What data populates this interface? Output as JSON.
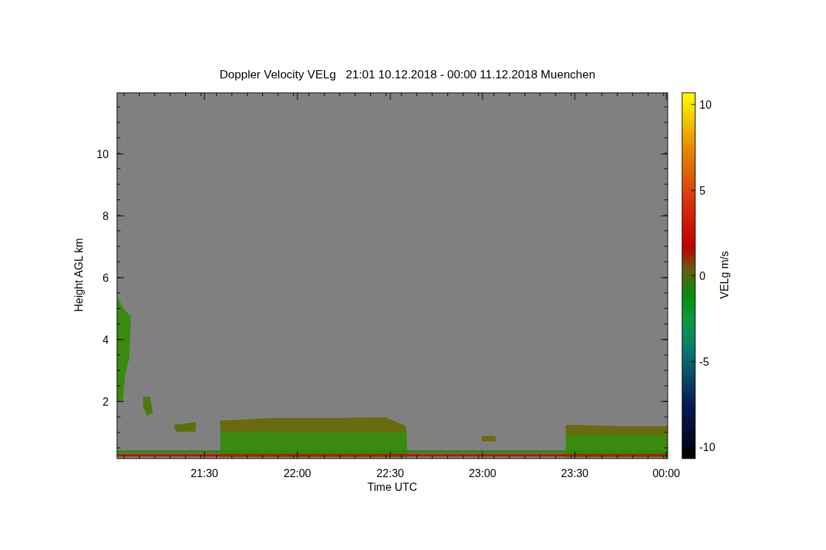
{
  "title": "Doppler Velocity VELg   21:01 10.12.2018 - 00:00 11.12.2018 Muenchen",
  "plot": {
    "xlabel": "Time UTC",
    "ylabel": "Height AGL km",
    "xticks": [
      "21:30",
      "22:00",
      "22:30",
      "23:00",
      "23:30",
      "00:00"
    ],
    "yticks": [
      "10",
      "8",
      "6",
      "4",
      "2"
    ]
  },
  "colorbar": {
    "label": "VELg m/s",
    "ticks": [
      "10",
      "5",
      "0",
      "-5",
      "-10"
    ]
  }
}
